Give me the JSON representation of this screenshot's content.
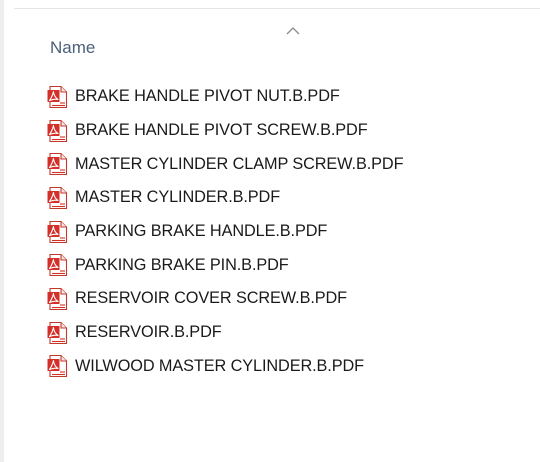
{
  "header": {
    "column_name": "Name",
    "sort_indicator_icon": "chevron-up-icon"
  },
  "file_icon": "pdf-file-icon",
  "files": [
    {
      "name": "BRAKE HANDLE PIVOT NUT.B.PDF"
    },
    {
      "name": "BRAKE HANDLE PIVOT SCREW.B.PDF"
    },
    {
      "name": "MASTER CYLINDER CLAMP SCREW.B.PDF"
    },
    {
      "name": "MASTER CYLINDER.B.PDF"
    },
    {
      "name": "PARKING BRAKE HANDLE.B.PDF"
    },
    {
      "name": "PARKING BRAKE PIN.B.PDF"
    },
    {
      "name": "RESERVOIR COVER SCREW.B.PDF"
    },
    {
      "name": "RESERVOIR.B.PDF"
    },
    {
      "name": "WILWOOD MASTER CYLINDER.B.PDF"
    }
  ],
  "colors": {
    "header_text": "#4c607a",
    "pdf_icon_red": "#d4302a"
  }
}
